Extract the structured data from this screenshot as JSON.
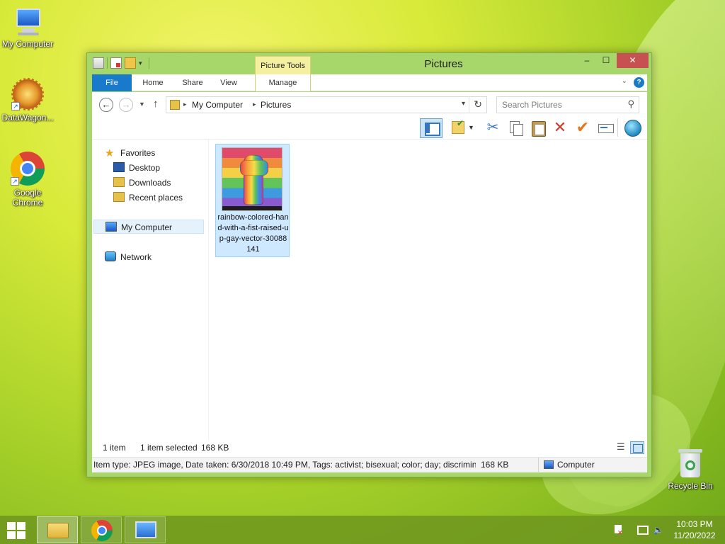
{
  "desktop": {
    "icons": [
      {
        "label": "My Computer",
        "icon": "computer-icon"
      },
      {
        "label": "DataWagon...",
        "icon": "datawagon-icon"
      },
      {
        "label": "Google Chrome",
        "icon": "chrome-icon"
      },
      {
        "label": "Recycle Bin",
        "icon": "recycle-bin-icon"
      }
    ]
  },
  "window": {
    "title": "Pictures",
    "context_tab": "Picture Tools",
    "controls": {
      "minimize": "–",
      "maximize": "☐",
      "close": "✕"
    },
    "ribbon_tabs": {
      "file": "File",
      "home": "Home",
      "share": "Share",
      "view": "View",
      "manage": "Manage"
    },
    "help": "?"
  },
  "address": {
    "breadcrumb": [
      "My Computer",
      "Pictures"
    ],
    "search_placeholder": "Search Pictures"
  },
  "nav": {
    "favorites": "Favorites",
    "desktop": "Desktop",
    "downloads": "Downloads",
    "recent_places": "Recent places",
    "my_computer": "My Computer",
    "network": "Network"
  },
  "files": [
    {
      "name": "rainbow-colored-hand-with-a-fist-raised-up-gay-vector-30088141",
      "selected": true
    }
  ],
  "status": {
    "count": "1 item",
    "selected": "1 item selected",
    "size": "168 KB"
  },
  "details": {
    "text": "Item type: JPEG image, Date taken: 6/30/2018 10:49 PM, Tags: activist; bisexual; color; day; discriminatio",
    "size": "168 KB",
    "zone": "Computer"
  },
  "taskbar": {
    "time": "10:03 PM",
    "date": "11/20/2022"
  },
  "colors": {
    "file_tab": "#1979ca",
    "close_button": "#c75050",
    "selection": "#cde8ff",
    "window_frame": "#a7d66a"
  }
}
